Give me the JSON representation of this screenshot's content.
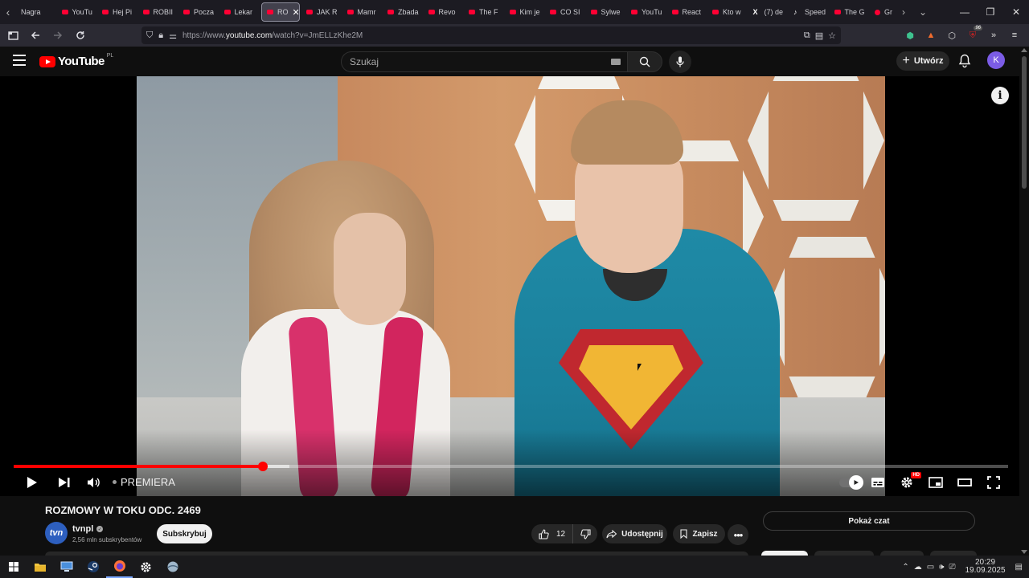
{
  "browser": {
    "tabs": [
      {
        "label": "Nagra",
        "icon": "none"
      },
      {
        "label": "YouTu",
        "icon": "youtube"
      },
      {
        "label": "Hej Pi",
        "icon": "youtube"
      },
      {
        "label": "ROBII",
        "icon": "youtube"
      },
      {
        "label": "Pocza",
        "icon": "youtube"
      },
      {
        "label": "Lekar",
        "icon": "youtube"
      },
      {
        "label": "RO",
        "icon": "youtube",
        "active": true
      },
      {
        "label": "JAK R",
        "icon": "youtube"
      },
      {
        "label": "Mamr",
        "icon": "youtube"
      },
      {
        "label": "Zbada",
        "icon": "youtube"
      },
      {
        "label": "Revo",
        "icon": "youtube"
      },
      {
        "label": "The F",
        "icon": "youtube"
      },
      {
        "label": "Kim je",
        "icon": "youtube"
      },
      {
        "label": "CO SI",
        "icon": "youtube"
      },
      {
        "label": "Sylwe",
        "icon": "youtube"
      },
      {
        "label": "YouTu",
        "icon": "youtube"
      },
      {
        "label": "React",
        "icon": "youtube"
      },
      {
        "label": "Kto w",
        "icon": "youtube"
      },
      {
        "label": "(7) de",
        "icon": "x"
      },
      {
        "label": "Speed",
        "icon": "tiktok"
      },
      {
        "label": "The G",
        "icon": "youtube"
      },
      {
        "label": "Gr",
        "icon": "red-dot"
      }
    ],
    "url_prefix": "https://www.",
    "url_host": "youtube.com",
    "url_path": "/watch?v=JmELLzKhe2M",
    "extension_badge": "96"
  },
  "youtube": {
    "logo_word": "YouTube",
    "country_code": "PL",
    "search_placeholder": "Szukaj",
    "create_label": "Utwórz",
    "avatar_letter": "K"
  },
  "player": {
    "progress_played": 0.251,
    "progress_buffered": 0.277,
    "live_label": "PREMIERA",
    "info_glyph": "i",
    "hd_badge": "HD"
  },
  "video": {
    "title": "ROZMOWY W TOKU ODC. 2469",
    "channel_name": "tvnpl",
    "channel_avatar_text": "tvn",
    "subscribers": "2,56 mln subskrybentów",
    "subscribe_label": "Subskrybuj",
    "like_count": "12",
    "share_label": "Udostępnij",
    "save_label": "Zapisz",
    "show_chat_label": "Pokaż czat"
  },
  "taskbar": {
    "time": "20:29",
    "date": "19.09.2025"
  },
  "colors": {
    "youtube_red": "#ff0000",
    "progress_red": "#ff0000",
    "background": "#0f0f0f",
    "avatar_purple": "#7b5ce6"
  }
}
